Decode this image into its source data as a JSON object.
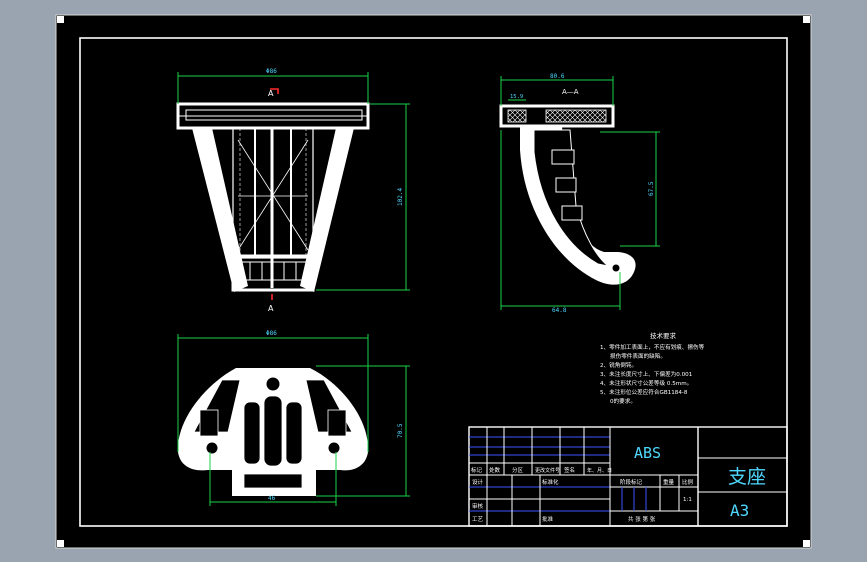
{
  "drawing": {
    "title_part": "支座",
    "material": "ABS",
    "sheet_size": "A3",
    "section_label": "A—A",
    "section_mark": "A",
    "section_mark_bottom": "A"
  },
  "dimensions": {
    "front_width": "Φ86",
    "front_height": "102.4",
    "side_width": "80.6",
    "side_small": "15.9",
    "side_height": "67.5",
    "side_bottom": "64.8",
    "bottom_width": "Φ86",
    "bottom_height": "70.5",
    "bottom_small": "46"
  },
  "notes": {
    "heading": "技术要求",
    "lines": [
      "1、零件加工表面上，不应有划痕、擦伤等",
      "损伤零件表面的缺陷。",
      "2、锐角倒钝。",
      "3、未注长度尺寸上、下偏差为0.001",
      "4、未注形状尺寸公差等级  0.5mm。",
      "5、未注形位公差应符合GB1184-8",
      "0的要求。"
    ]
  },
  "title_block": {
    "row_labels": [
      "标记",
      "处数",
      "分区",
      "更改文件号",
      "签名",
      "年、月、日"
    ],
    "design": "设计",
    "standard": "标准化",
    "stage_mark": "阶段标记",
    "weight": "重量",
    "scale": "比例",
    "scale_value": "1:1",
    "review": "审核",
    "craft": "工艺",
    "approve": "批准",
    "sheets": "共   张  第   张"
  }
}
